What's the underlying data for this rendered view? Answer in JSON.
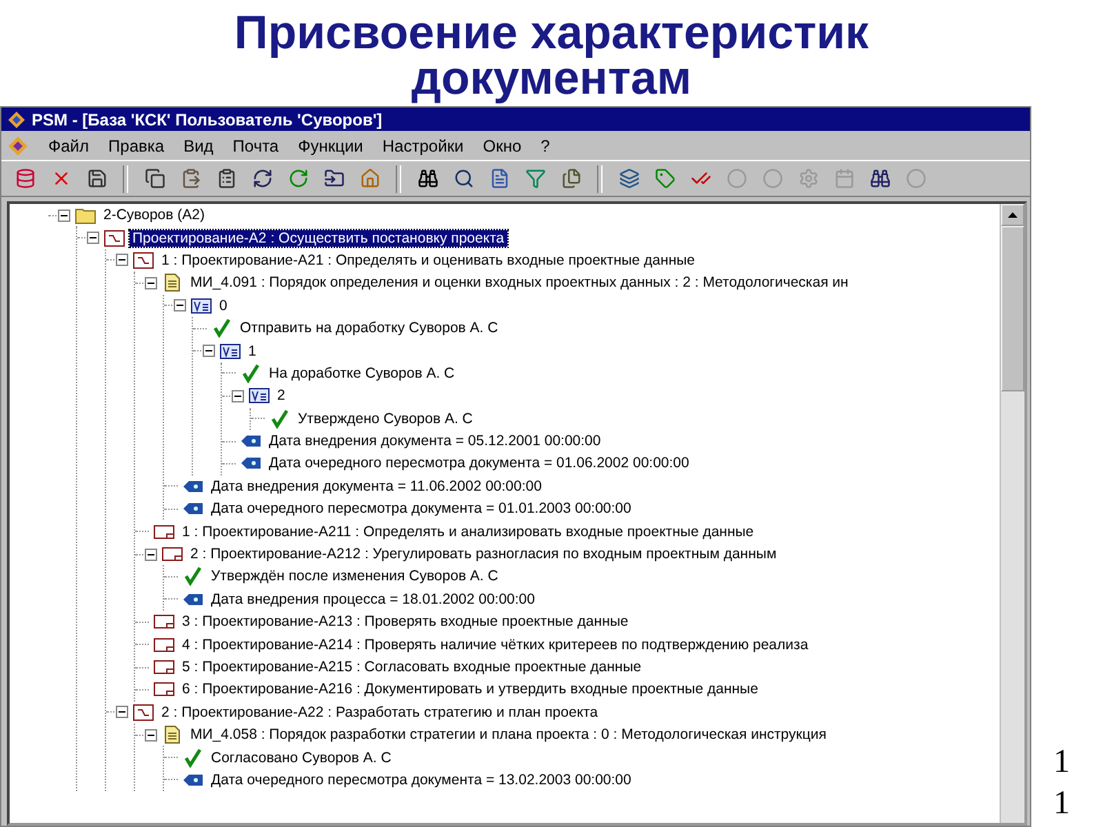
{
  "slide": {
    "title": "Присвоение характеристик документам",
    "page_number": "11"
  },
  "window": {
    "title": "PSM - [База 'КСК' Пользователь 'Суворов']"
  },
  "menu": [
    "Файл",
    "Правка",
    "Вид",
    "Почта",
    "Функции",
    "Настройки",
    "Окно",
    "?"
  ],
  "tree": [
    {
      "kind": "folder",
      "label": "2-Суворов (А2)",
      "expanded": true,
      "selected": false,
      "children": [
        {
          "kind": "process",
          "label": "Проектирование-А2 : Осуществить постановку проекта",
          "expanded": true,
          "selected": true,
          "children": [
            {
              "kind": "process",
              "label": "1 : Проектирование-А21 : Определять и оценивать входные проектные данные",
              "expanded": true,
              "selected": false,
              "children": [
                {
                  "kind": "document",
                  "label": "МИ_4.091 : Порядок определения и оценки входных проектных данных : 2 : Методологическая ин",
                  "expanded": true,
                  "selected": false,
                  "children": [
                    {
                      "kind": "version",
                      "label": "0",
                      "expanded": true,
                      "selected": false,
                      "children": [
                        {
                          "kind": "approval",
                          "label": "Отправить на доработку  Суворов А. С",
                          "selected": false
                        },
                        {
                          "kind": "version",
                          "label": "1",
                          "expanded": true,
                          "selected": false,
                          "children": [
                            {
                              "kind": "approval",
                              "label": "На доработке  Суворов А. С",
                              "selected": false
                            },
                            {
                              "kind": "version",
                              "label": "2",
                              "expanded": true,
                              "selected": false,
                              "children": [
                                {
                                  "kind": "approval",
                                  "label": "Утверждено  Суворов А. С",
                                  "selected": false
                                }
                              ]
                            },
                            {
                              "kind": "attribute",
                              "label": "Дата внедрения документа = 05.12.2001  00:00:00",
                              "selected": false
                            },
                            {
                              "kind": "attribute",
                              "label": "Дата очередного пересмотра документа = 01.06.2002  00:00:00",
                              "selected": false
                            }
                          ]
                        }
                      ]
                    },
                    {
                      "kind": "attribute",
                      "label": "Дата внедрения документа = 11.06.2002  00:00:00",
                      "selected": false
                    },
                    {
                      "kind": "attribute",
                      "label": "Дата очередного пересмотра документа = 01.01.2003  00:00:00",
                      "selected": false
                    }
                  ]
                },
                {
                  "kind": "task",
                  "label": "1 : Проектирование-А211 : Определять и анализировать входные проектные данные",
                  "selected": false
                },
                {
                  "kind": "task",
                  "label": "2 : Проектирование-А212 : Урегулировать разногласия по входным проектным данным",
                  "expanded": true,
                  "selected": false,
                  "children": [
                    {
                      "kind": "approval",
                      "label": "Утверждён после изменения  Суворов А. С",
                      "selected": false
                    },
                    {
                      "kind": "attribute",
                      "label": "Дата внедрения процесса = 18.01.2002  00:00:00",
                      "selected": false
                    }
                  ]
                },
                {
                  "kind": "task",
                  "label": "3 : Проектирование-А213 : Проверять входные проектные данные",
                  "selected": false
                },
                {
                  "kind": "task",
                  "label": "4 : Проектирование-А214 : Проверять наличие чётких критереев по подтверждению реализа",
                  "selected": false
                },
                {
                  "kind": "task",
                  "label": "5 : Проектирование-А215 : Согласовать входные проектные данные",
                  "selected": false
                },
                {
                  "kind": "task",
                  "label": "6 : Проектирование-А216 : Документировать и утвердить входные проектные данные",
                  "selected": false
                }
              ]
            },
            {
              "kind": "process",
              "label": "2 : Проектирование-А22 : Разработать стратегию и план проекта",
              "expanded": true,
              "selected": false,
              "children": [
                {
                  "kind": "document",
                  "label": "МИ_4.058 : Порядок разработки стратегии и плана проекта : 0 : Методологическая инструкция",
                  "expanded": true,
                  "selected": false,
                  "children": [
                    {
                      "kind": "approval",
                      "label": "Согласовано  Суворов А. С",
                      "selected": false
                    },
                    {
                      "kind": "attribute",
                      "label": "Дата очередного пересмотра документа = 13.02.2003  00:00:00",
                      "selected": false
                    }
                  ]
                }
              ]
            }
          ]
        }
      ]
    }
  ]
}
